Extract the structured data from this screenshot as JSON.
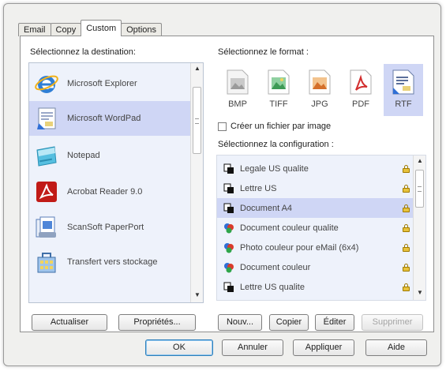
{
  "tabs": [
    "Email",
    "Copy",
    "Custom",
    "Options"
  ],
  "destination": {
    "label": "Sélectionnez la destination:",
    "items": [
      {
        "name": "Microsoft Explorer",
        "icon": "internet-explorer-icon"
      },
      {
        "name": "Microsoft WordPad",
        "icon": "wordpad-icon"
      },
      {
        "name": "Notepad",
        "icon": "notepad-icon"
      },
      {
        "name": "Acrobat Reader 9.0",
        "icon": "acrobat-reader-icon"
      },
      {
        "name": "ScanSoft PaperPort",
        "icon": "paperport-icon"
      },
      {
        "name": "Transfert vers stockage",
        "icon": "storage-transfer-icon"
      }
    ],
    "selected_index": 1
  },
  "format": {
    "label": "Sélectionnez le format :",
    "items": [
      "BMP",
      "TIFF",
      "JPG",
      "PDF",
      "RTF"
    ],
    "selected": "RTF"
  },
  "checkbox": {
    "label": "Créer un fichier par image",
    "checked": false
  },
  "configuration": {
    "label": "Sélectionnez la configuration :",
    "items": [
      {
        "name": "Legale US qualite",
        "icon": "bw-document-icon"
      },
      {
        "name": "Lettre US",
        "icon": "bw-document-icon"
      },
      {
        "name": "Document A4",
        "icon": "bw-document-icon"
      },
      {
        "name": "Document couleur qualite",
        "icon": "color-document-icon"
      },
      {
        "name": "Photo couleur pour eMail (6x4)",
        "icon": "color-document-icon"
      },
      {
        "name": "Document couleur",
        "icon": "color-document-icon"
      },
      {
        "name": "Lettre US qualite",
        "icon": "bw-document-icon"
      }
    ],
    "selected_index": 2
  },
  "buttons": {
    "refresh": "Actualiser",
    "properties": "Propriétés...",
    "new": "Nouv...",
    "copy": "Copier",
    "edit": "Éditer",
    "delete": "Supprimer",
    "ok": "OK",
    "cancel": "Annuler",
    "apply": "Appliquer",
    "help": "Aide"
  },
  "colors": {
    "selection": "#cfd6f5",
    "list_background": "#eef2fb",
    "default_button_border": "#2e7fba"
  }
}
